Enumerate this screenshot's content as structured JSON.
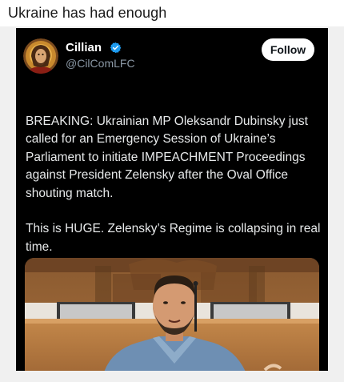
{
  "post": {
    "title": "Ukraine has had enough"
  },
  "tweet": {
    "author_name": "Cillian",
    "author_handle": "@CilComLFC",
    "follow_label": "Follow",
    "verified_icon": "verified-badge-icon",
    "flag_icon": "ukraine-flag-icon",
    "paragraph_1": "BREAKING: Ukrainian MP Oleksandr Dubinsky just called for an Emergency Session of Ukraine’s Parliament to initiate IMPEACHMENT Proceedings against President Zelensky after the Oval Office shouting match.",
    "paragraph_2": "This is HUGE. Zelensky’s Regime is collapsing in real time."
  },
  "colors": {
    "card_background": "#000000",
    "text": "#e7e9ea",
    "handle": "#8b98a5",
    "verified": "#1d9bf0",
    "flag_blue": "#0057b7",
    "flag_yellow": "#ffd700"
  }
}
